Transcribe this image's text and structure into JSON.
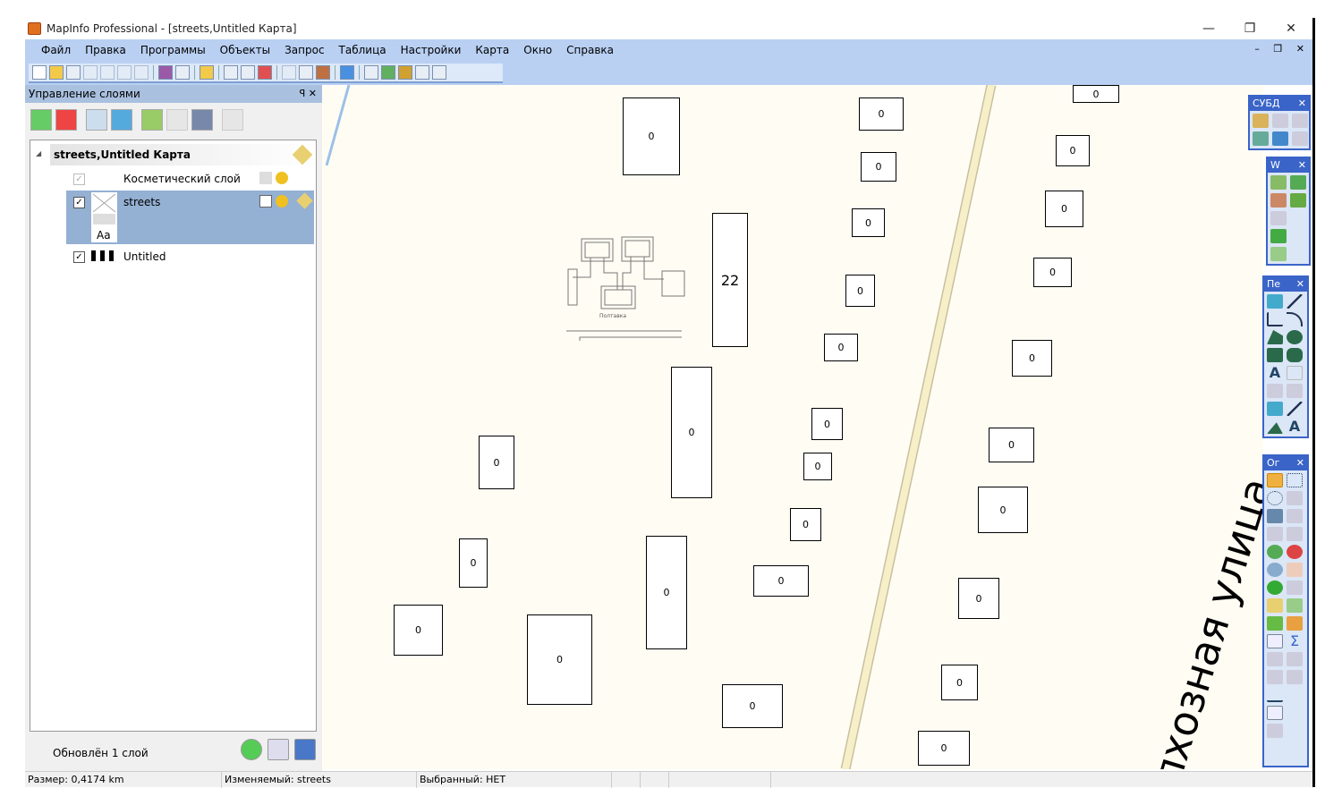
{
  "window": {
    "title": "MapInfo Professional - [streets,Untitled Карта]",
    "minimize": "—",
    "restore": "❐",
    "close": "✕"
  },
  "menu": {
    "items": [
      "Файл",
      "Правка",
      "Программы",
      "Объекты",
      "Запрос",
      "Таблица",
      "Настройки",
      "Карта",
      "Окно",
      "Справка"
    ],
    "mdi_controls": "– ❐ ✕"
  },
  "layer_panel": {
    "title": "Управление слоями",
    "pin": "ᵖ",
    "close": "✕",
    "tree": {
      "root": "streets,Untitled Карта",
      "layers": [
        {
          "name": "Косметический слой",
          "checked": true,
          "disabled": true
        },
        {
          "name": "streets",
          "checked": true,
          "selected": true,
          "thumb_label": "Aa"
        },
        {
          "name": "Untitled",
          "checked": true
        }
      ]
    },
    "footer_text": "Обновлён 1 слой"
  },
  "map": {
    "street_label": "Колхозная улица",
    "diagram_label": "Полтавка",
    "boxes": [
      "0",
      "0",
      "0",
      "0",
      "0",
      "0",
      "0",
      "22",
      "0",
      "0",
      "0",
      "0",
      "0",
      "0",
      "0",
      "0",
      "0",
      "0",
      "0",
      "0",
      "0",
      "0",
      "0",
      "0",
      "0",
      "0",
      "0",
      "0"
    ],
    "colors": {
      "background": "#fffdf3",
      "street_fill": "#f6efc8",
      "street_edge": "#c8c0a0"
    }
  },
  "float_toolbars": [
    {
      "title": "СУБД"
    },
    {
      "title": "W"
    },
    {
      "title": "Пе"
    },
    {
      "title": "Ог"
    }
  ],
  "status": {
    "size": "Размер: 0,4174 km",
    "editable": "Изменяемый: streets",
    "selected": "Выбранный: НЕТ"
  }
}
